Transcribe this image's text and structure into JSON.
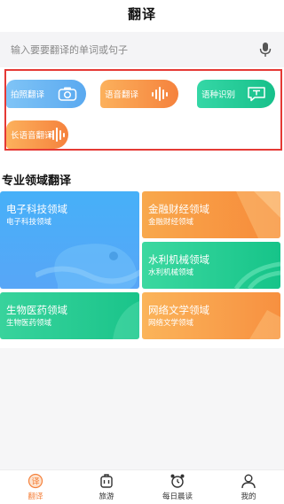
{
  "header": {
    "title": "翻译"
  },
  "search": {
    "placeholder": "输入要要翻译的单词或句子",
    "icon": "mic-icon"
  },
  "quick_actions": [
    {
      "label": "拍照翻译",
      "icon": "camera-icon"
    },
    {
      "label": "语音翻译",
      "icon": "waveform-icon"
    },
    {
      "label": "语种识别",
      "icon": "text-bubble-icon"
    },
    {
      "label": "长语音翻译",
      "icon": "waveform-icon"
    }
  ],
  "section": {
    "title": "专业领域翻译"
  },
  "domains": [
    {
      "title": "电子科技领域",
      "subtitle": "电子科技领域"
    },
    {
      "title": "金融财经领域",
      "subtitle": "金融财经领域"
    },
    {
      "title": "水利机械领域",
      "subtitle": "水利机械领域"
    },
    {
      "title": "生物医药领域",
      "subtitle": "生物医药领域"
    },
    {
      "title": "网络文学领域",
      "subtitle": "网络文学领域"
    }
  ],
  "tabbar": [
    {
      "label": "翻译",
      "icon": "translate-icon",
      "active": true
    },
    {
      "label": "旅游",
      "icon": "luggage-icon",
      "active": false
    },
    {
      "label": "每日晨读",
      "icon": "alarm-clock-icon",
      "active": false
    },
    {
      "label": "我的",
      "icon": "user-icon",
      "active": false
    }
  ],
  "colors": {
    "accent": "#f5823d",
    "blue": "#4aaef7",
    "green": "#1ac48a",
    "red_frame": "#e53935"
  }
}
